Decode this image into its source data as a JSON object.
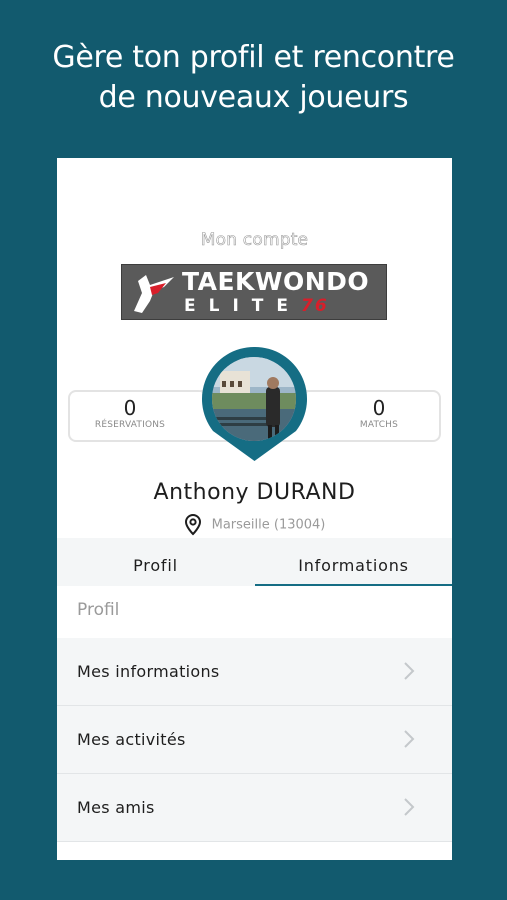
{
  "headline": {
    "line1": "Gère ton profil et rencontre",
    "line2": "de nouveaux joueurs"
  },
  "account": {
    "title": "Mon compte",
    "logo": {
      "text_main": "TAEKWONDO",
      "text_sub": "ELITE",
      "text_num": "76"
    }
  },
  "stats": {
    "reservations": {
      "value": "0",
      "label": "RÉSERVATIONS"
    },
    "matchs": {
      "value": "0",
      "label": "MATCHS"
    }
  },
  "user": {
    "first_name": "Anthony",
    "last_name": "DURAND",
    "location": "Marseille (13004)"
  },
  "tabs": [
    {
      "label": "Profil",
      "active": false
    },
    {
      "label": "Informations",
      "active": true
    }
  ],
  "section": {
    "title": "Profil"
  },
  "menu": [
    {
      "label": "Mes informations",
      "icon": "chevron-right-icon"
    },
    {
      "label": "Mes activités",
      "icon": "chevron-right-icon"
    },
    {
      "label": "Mes amis",
      "icon": "chevron-right-icon"
    }
  ],
  "colors": {
    "background": "#125a6e",
    "accent": "#156d84",
    "logo_red": "#d81e2a"
  }
}
